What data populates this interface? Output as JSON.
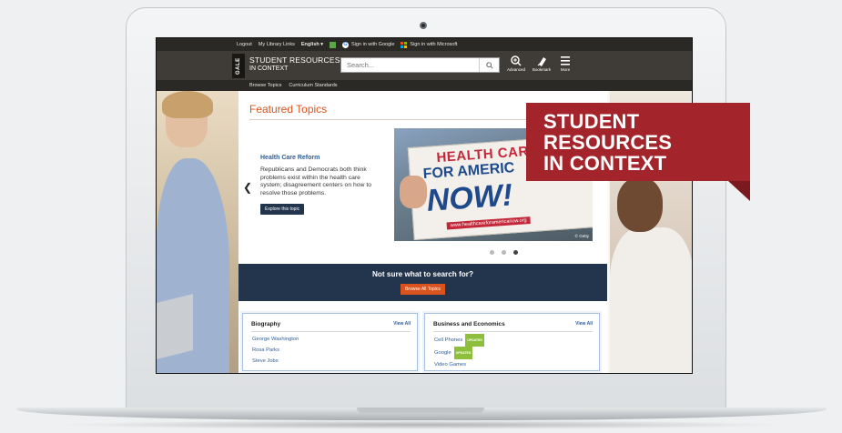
{
  "topbar": {
    "logout": "Logout",
    "library_links": "My Library Links",
    "language": "English ▾",
    "google_signin": "Sign in with Google",
    "microsoft_signin": "Sign in with Microsoft"
  },
  "header": {
    "gale": "GALE",
    "brand_line1": "STUDENT RESOURCES",
    "brand_line2": "IN CONTEXT",
    "search_placeholder": "Search...",
    "tools": [
      {
        "label": "Advanced",
        "icon": "advanced-search-icon"
      },
      {
        "label": "Bookmark",
        "icon": "bookmark-icon"
      },
      {
        "label": "More",
        "icon": "menu-icon"
      }
    ]
  },
  "subnav": {
    "browse_topics": "Browse Topics",
    "curriculum_standards": "Curriculum Standards"
  },
  "featured": {
    "title": "Featured Topics",
    "slide": {
      "heading": "Health Care Reform",
      "description": "Republicans and Democrats both think problems exist within the health care system; disagreement centers on how to resolve those problems.",
      "button": "Explore this topic",
      "image_text": {
        "line1": "HEALTH CAR",
        "line2": "FOR AMERIC",
        "line3": "NOW!",
        "url": "www.healthcareforamericanow.org",
        "credit": "© Getty"
      }
    },
    "dots": 3,
    "active_dot": 3
  },
  "promo": {
    "question": "Not sure what to search for?",
    "button": "Browse All Topics"
  },
  "cards": [
    {
      "title": "Biography",
      "view_all": "View All",
      "items": [
        {
          "label": "George Washington",
          "badge": ""
        },
        {
          "label": "Rosa Parks",
          "badge": ""
        },
        {
          "label": "Steve Jobs",
          "badge": ""
        }
      ]
    },
    {
      "title": "Business and Economics",
      "view_all": "View All",
      "items": [
        {
          "label": "Cell Phones",
          "badge": "UPDATED"
        },
        {
          "label": "Google",
          "badge": "UPDATED"
        },
        {
          "label": "Video Games",
          "badge": ""
        }
      ]
    }
  ],
  "banner": {
    "line1": "STUDENT",
    "line2": "RESOURCES",
    "line3": "IN CONTEXT"
  },
  "colors": {
    "accent_orange": "#d9531e",
    "navy": "#23344d",
    "link_blue": "#2f5e9a",
    "banner_red": "#a3242a",
    "badge_green": "#8dbf3c"
  }
}
